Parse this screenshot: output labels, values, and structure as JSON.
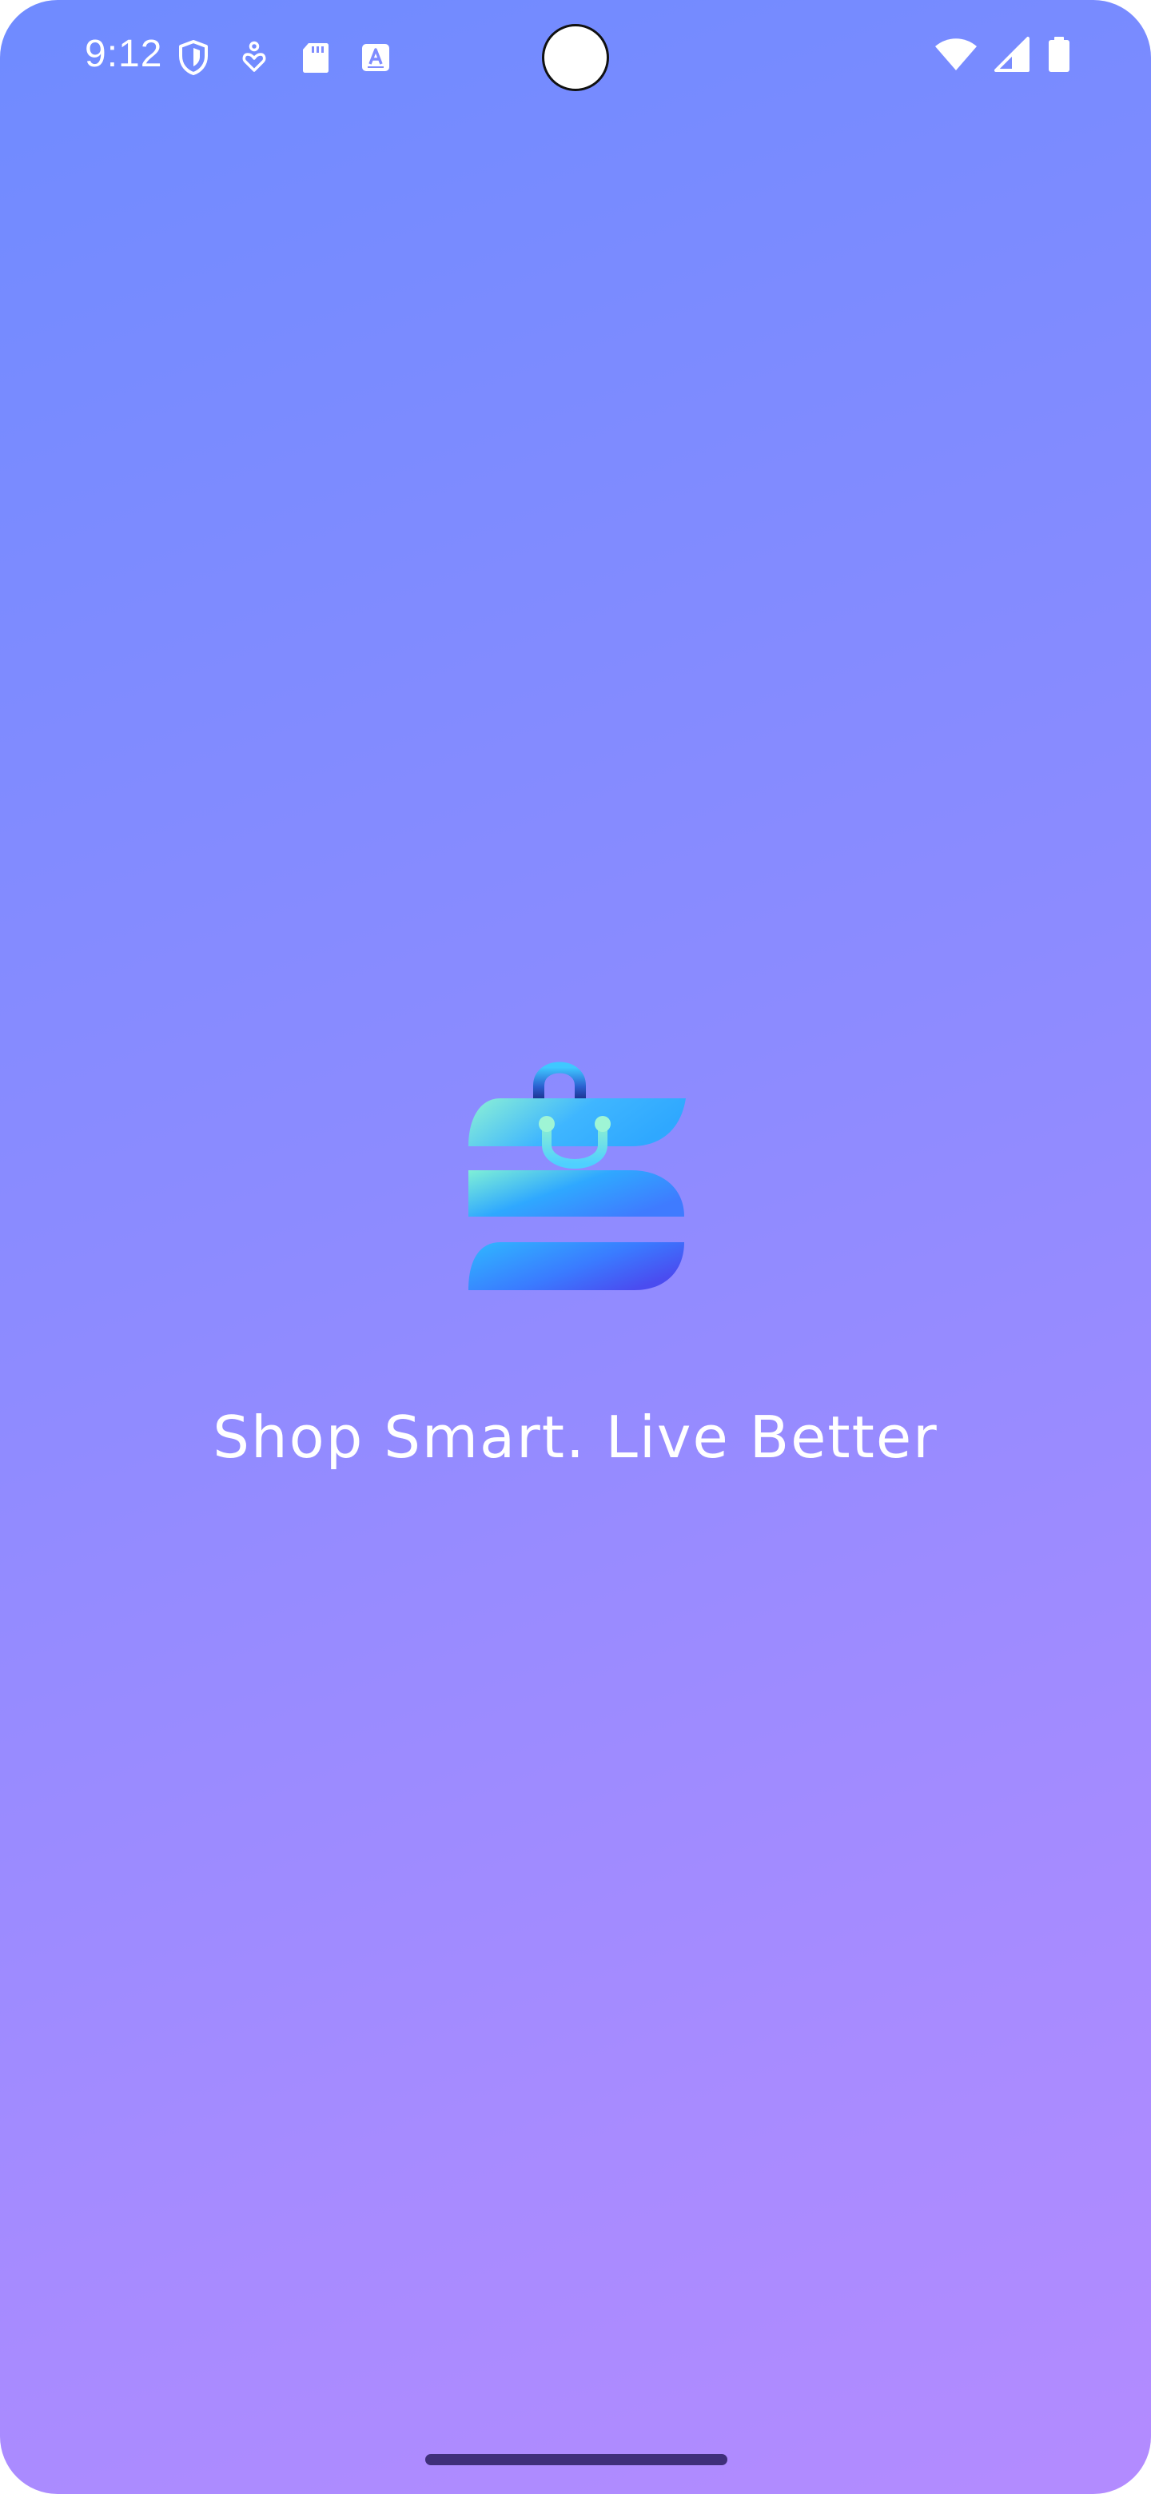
{
  "status_bar": {
    "time": "9:12",
    "left_icons": [
      "shield-icon",
      "accessibility-icon",
      "sd-card-icon",
      "font-icon"
    ],
    "right_icons": [
      "wifi-icon",
      "cellular-signal-icon",
      "battery-icon"
    ]
  },
  "splash": {
    "logo": "shopping-bag-logo",
    "tagline": "Shop Smart. Live Better"
  },
  "colors": {
    "gradient_start": "#6f8bff",
    "gradient_end": "#b38bff",
    "logo_teal": "#7ff0d6",
    "logo_blue": "#2fa8ff",
    "logo_indigo": "#4a4cf0",
    "text": "#ffffff",
    "gesture_bar": "#3f2f7a"
  },
  "navigation": {
    "gesture_bar": "home-gesture-handle"
  }
}
